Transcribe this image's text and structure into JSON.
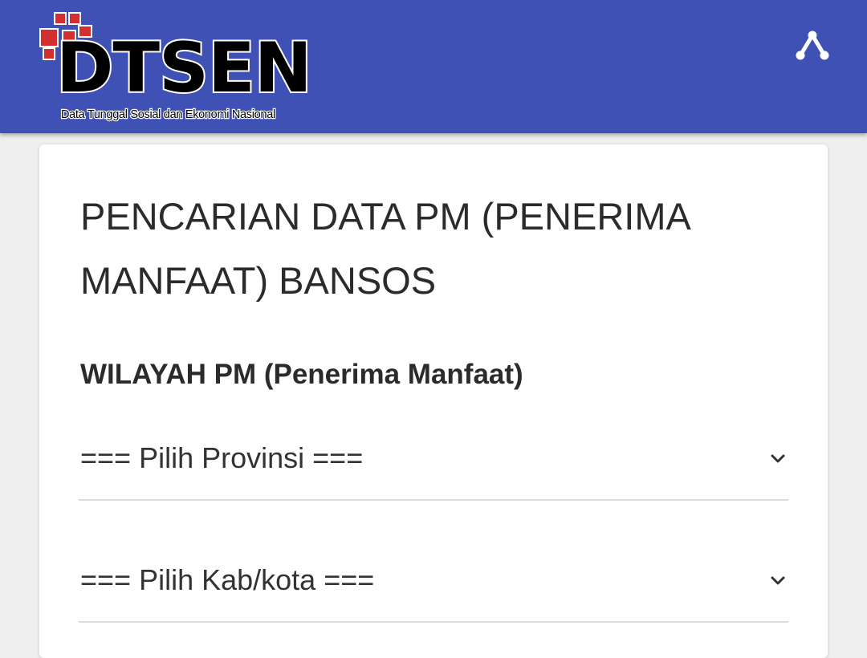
{
  "header": {
    "logo_text": "DTSEN",
    "logo_tagline": "Data Tunggal Sosial dan Ekonomi Nasional",
    "share_icon": "share-icon",
    "bg_color": "#3f51b5",
    "logo_square_color": "#d32f2f"
  },
  "main": {
    "title": "PENCARIAN DATA PM (PENERIMA MANFAAT) BANSOS",
    "section_title": "WILAYAH PM (Penerima Manfaat)",
    "province_select": {
      "value": "=== Pilih Provinsi ==="
    },
    "city_select": {
      "value": "=== Pilih Kab/kota ==="
    }
  }
}
